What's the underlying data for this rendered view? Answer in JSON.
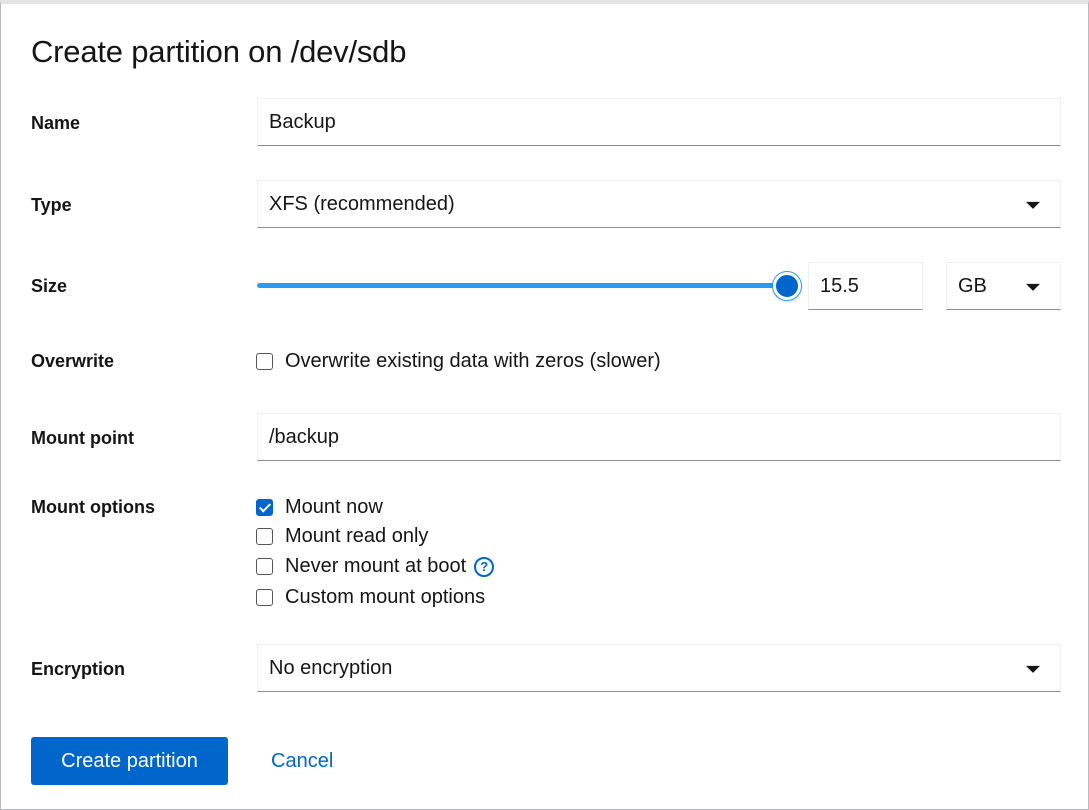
{
  "dialog": {
    "title": "Create partition on /dev/sdb",
    "name": {
      "label": "Name",
      "value": "Backup"
    },
    "type": {
      "label": "Type",
      "selected": "XFS (recommended)"
    },
    "size": {
      "label": "Size",
      "value": "15.5",
      "unit": "GB",
      "slider_fraction": 1.0
    },
    "overwrite": {
      "label": "Overwrite",
      "option": "Overwrite existing data with zeros (slower)",
      "checked": false
    },
    "mount_point": {
      "label": "Mount point",
      "value": "/backup"
    },
    "mount_options": {
      "label": "Mount options",
      "items": [
        {
          "label": "Mount now",
          "checked": true
        },
        {
          "label": "Mount read only",
          "checked": false
        },
        {
          "label": "Never mount at boot",
          "checked": false,
          "help_icon": "question-circle-icon"
        },
        {
          "label": "Custom mount options",
          "checked": false
        }
      ]
    },
    "encryption": {
      "label": "Encryption",
      "selected": "No encryption"
    },
    "actions": {
      "primary": "Create partition",
      "cancel": "Cancel"
    }
  },
  "colors": {
    "accent": "#0066cc",
    "slider_fill": "#2b9af3"
  }
}
